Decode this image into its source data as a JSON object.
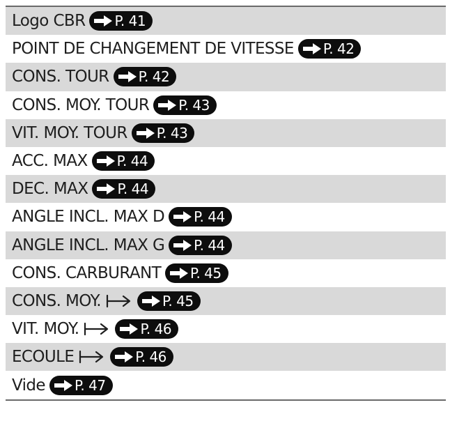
{
  "rows": [
    {
      "label": "Logo CBR",
      "page": "P. 41",
      "mapsto": false
    },
    {
      "label": "POINT DE CHANGEMENT DE VITESSE",
      "page": "P. 42",
      "mapsto": false
    },
    {
      "label": "CONS. TOUR",
      "page": "P. 42",
      "mapsto": false
    },
    {
      "label": "CONS. MOY. TOUR",
      "page": "P. 43",
      "mapsto": false
    },
    {
      "label": "VIT. MOY. TOUR",
      "page": "P. 43",
      "mapsto": false
    },
    {
      "label": "ACC. MAX",
      "page": "P. 44",
      "mapsto": false
    },
    {
      "label": "DEC. MAX",
      "page": "P. 44",
      "mapsto": false
    },
    {
      "label": "ANGLE INCL. MAX D",
      "page": "P. 44",
      "mapsto": false
    },
    {
      "label": "ANGLE INCL. MAX G",
      "page": "P. 44",
      "mapsto": false
    },
    {
      "label": "CONS. CARBURANT",
      "page": "P. 45",
      "mapsto": false
    },
    {
      "label": "CONS. MOY.",
      "page": "P. 45",
      "mapsto": true
    },
    {
      "label": "VIT. MOY.",
      "page": "P. 46",
      "mapsto": true
    },
    {
      "label": "ECOULE",
      "page": "P. 46",
      "mapsto": true
    },
    {
      "label": "Vide",
      "page": "P. 47",
      "mapsto": false
    }
  ],
  "icons": {
    "page_ref": "right-arrow-icon",
    "mapsto": "maps-to-arrow-icon"
  },
  "colors": {
    "row_shade": "#d9d9d9",
    "row_plain": "#ffffff",
    "badge_bg": "#0d0d0d",
    "badge_text": "#ffffff",
    "text": "#1e1e1e",
    "rule": "#6a6a6a"
  }
}
